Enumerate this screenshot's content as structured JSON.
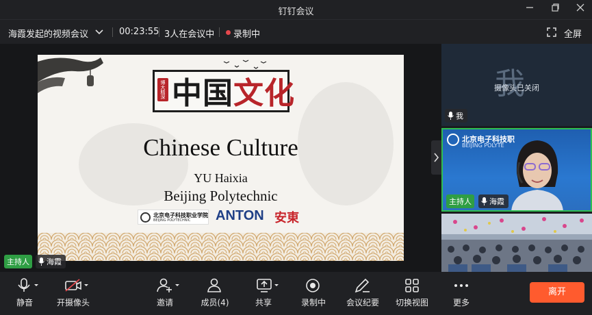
{
  "window": {
    "title": "钉钉会议"
  },
  "info": {
    "meeting_name": "海霞发起的视频会议",
    "timer": "00:23:55",
    "participants_in": "3人在会议中",
    "recording": "录制中",
    "fullscreen": "全屏"
  },
  "slide": {
    "seal_text": "博大精深",
    "cn_title_a": "中国",
    "cn_title_b": "文化",
    "en_title": "Chinese Culture",
    "author": "YU Haixia",
    "school": "Beijing Polytechnic",
    "logo_bp_cn": "北京电子科技职业学院",
    "logo_bp_en": "BEIJING POLYTECHNIC",
    "logo_anton": "ANTON",
    "logo_anton_cn": "安東"
  },
  "stage_labels": {
    "host": "主持人",
    "name": "海霞"
  },
  "tiles": {
    "self": {
      "avatar": "我",
      "status": "摄像头已关闭",
      "name": "我"
    },
    "host": {
      "logo_cn": "北京电子科技职",
      "logo_en": "BEIJING POLYTE",
      "role": "主持人",
      "name": "海霞"
    }
  },
  "toolbar": {
    "mute": "静音",
    "camera": "开摄像头",
    "invite": "邀请",
    "members": "成员(4)",
    "share": "共享",
    "recording": "录制中",
    "minutes": "会议纪要",
    "view": "切换视图",
    "more": "更多",
    "leave": "离开"
  },
  "colors": {
    "accent_green": "#2fbf51",
    "leave": "#ff5b2e",
    "record": "#e5484d"
  }
}
